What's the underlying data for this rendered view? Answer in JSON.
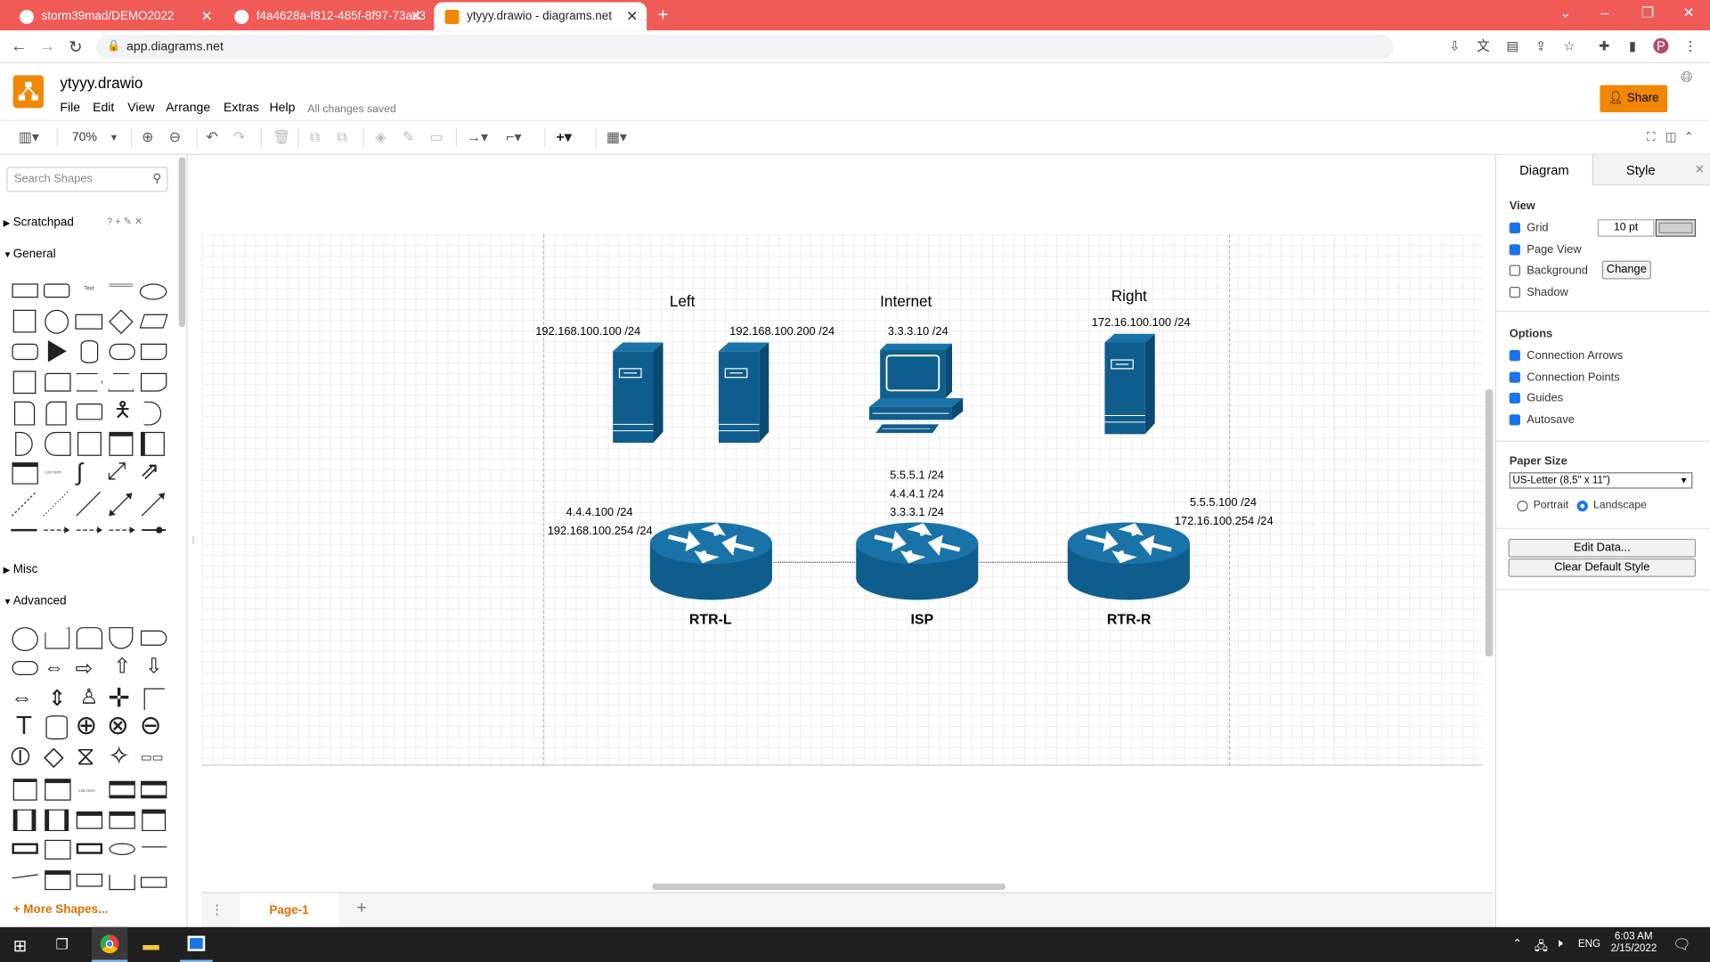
{
  "browser": {
    "tabs": [
      {
        "title": "storm39mad/DEMO2022"
      },
      {
        "title": "f4a4628a-f812-485f-8f97-73ad3"
      },
      {
        "title": "ytyyy.drawio - diagrams.net"
      }
    ],
    "url": "app.diagrams.net",
    "profile_initial": "P"
  },
  "app": {
    "file_title": "ytyyy.drawio",
    "menus": [
      "File",
      "Edit",
      "View",
      "Arrange",
      "Extras",
      "Help"
    ],
    "save_status": "All changes saved",
    "share_label": "Share",
    "zoom": "70%"
  },
  "left_panel": {
    "search_placeholder": "Search Shapes",
    "scratchpad": "Scratchpad",
    "general": "General",
    "misc": "Misc",
    "advanced": "Advanced",
    "more_shapes": "+ More Shapes..."
  },
  "diagram": {
    "groups": {
      "left": "Left",
      "internet": "Internet",
      "right": "Right"
    },
    "ip_labels": {
      "pc_left1": "192.168.100.100 /24",
      "pc_left2": "192.168.100.200 /24",
      "internet": "3.3.3.10 /24",
      "right": "172.16.100.100 /24",
      "rtrl_1": "4.4.4.100 /24",
      "rtrl_2": "192.168.100.254 /24",
      "isp_1": "5.5.5.1 /24",
      "isp_2": "4.4.4.1 /24",
      "isp_3": "3.3.3.1 /24",
      "rtrr_1": "5.5.5.100 /24",
      "rtrr_2": "172.16.100.254 /24"
    },
    "routers": {
      "left": "RTR-L",
      "isp": "ISP",
      "right": "RTR-R"
    },
    "colors": {
      "device": "#0f5d8c"
    }
  },
  "page_tab": "Page-1",
  "right_panel": {
    "tabs": [
      "Diagram",
      "Style"
    ],
    "view_heading": "View",
    "grid": "Grid",
    "grid_size": "10 pt",
    "page_view": "Page View",
    "background": "Background",
    "change": "Change",
    "shadow": "Shadow",
    "options_heading": "Options",
    "connection_arrows": "Connection Arrows",
    "connection_points": "Connection Points",
    "guides": "Guides",
    "autosave": "Autosave",
    "paper_heading": "Paper Size",
    "paper_size": "US-Letter (8,5\" x 11\")",
    "portrait": "Portrait",
    "landscape": "Landscape",
    "edit_data": "Edit Data...",
    "clear_style": "Clear Default Style"
  },
  "taskbar": {
    "time": "6:03 AM",
    "date": "2/15/2022",
    "lang": "ENG"
  }
}
